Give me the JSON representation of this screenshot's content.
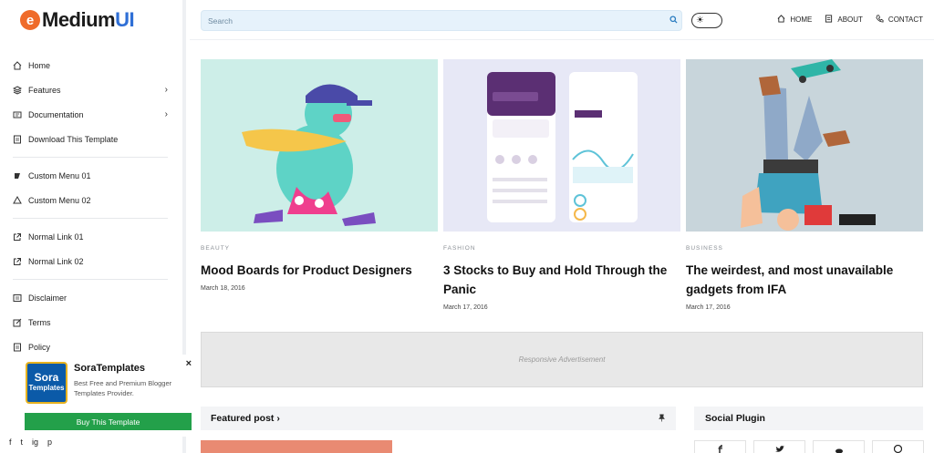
{
  "logo": {
    "mark": "e",
    "text_part1": "Medium",
    "text_part2": "UI"
  },
  "sidebar": {
    "items": [
      {
        "label": "Home",
        "icon": "home-icon",
        "has_chevron": false
      },
      {
        "label": "Features",
        "icon": "layers-icon",
        "has_chevron": true
      },
      {
        "label": "Documentation",
        "icon": "doc-icon",
        "has_chevron": true
      },
      {
        "label": "Download This Template",
        "icon": "download-icon",
        "has_chevron": false
      },
      {
        "label": "Custom Menu 01",
        "icon": "menu-icon",
        "has_chevron": false
      },
      {
        "label": "Custom Menu 02",
        "icon": "menu-icon",
        "has_chevron": false
      },
      {
        "label": "Normal Link 01",
        "icon": "external-link-icon",
        "has_chevron": false
      },
      {
        "label": "Normal Link 02",
        "icon": "external-link-icon",
        "has_chevron": false
      },
      {
        "label": "Disclaimer",
        "icon": "info-icon",
        "has_chevron": false
      },
      {
        "label": "Terms",
        "icon": "edit-icon",
        "has_chevron": false
      },
      {
        "label": "Policy",
        "icon": "shield-icon",
        "has_chevron": false
      }
    ],
    "chevron": "›"
  },
  "promo": {
    "close": "×",
    "badge_line1": "Sora",
    "badge_line2": "Templates",
    "title": "SoraTemplates",
    "description": "Best Free and Premium Blogger Templates Provider.",
    "button": "Buy This Template"
  },
  "social_bar": [
    "f",
    "t",
    "ig",
    "p"
  ],
  "header": {
    "search_placeholder": "Search",
    "nav": [
      {
        "label": "HOME",
        "icon": "home-icon"
      },
      {
        "label": "ABOUT",
        "icon": "doc-icon"
      },
      {
        "label": "CONTACT",
        "icon": "phone-icon"
      }
    ]
  },
  "posts": [
    {
      "category": "BEAUTY",
      "title": "Mood Boards for Product Designers",
      "date": "March 18, 2016"
    },
    {
      "category": "FASHION",
      "title": "3 Stocks to Buy and Hold Through the Panic",
      "date": "March 17, 2016"
    },
    {
      "category": "BUSINESS",
      "title": "The weirdest, and most unavailable gadgets from IFA",
      "date": "March 17, 2016"
    }
  ],
  "ad": "Responsive Advertisement",
  "featured": {
    "title": "Featured post ›"
  },
  "social_plugin": {
    "title": "Social Plugin"
  },
  "colors": {
    "accent_blue": "#2f6fd6",
    "logo_orange": "#ef6b2a",
    "buy_green": "#23a04a"
  }
}
